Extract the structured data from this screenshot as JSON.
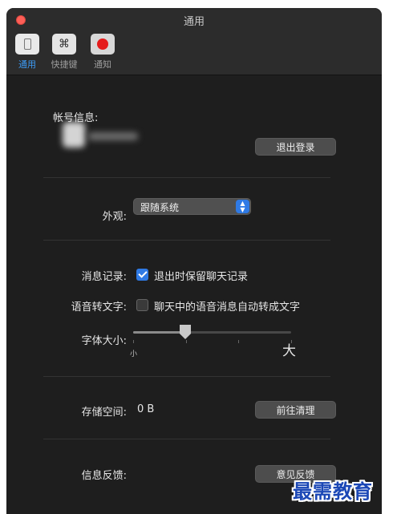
{
  "window": {
    "title": "通用"
  },
  "toolbar": {
    "items": [
      {
        "label": "通用",
        "icon": "general-icon",
        "active": true
      },
      {
        "label": "快捷键",
        "icon": "command-key-icon",
        "glyph": "⌘",
        "active": false
      },
      {
        "label": "通知",
        "icon": "notification-icon",
        "active": false
      }
    ]
  },
  "account": {
    "section_label": "帐号信息:",
    "logout_button": "退出登录"
  },
  "appearance": {
    "label": "外观:",
    "selected": "跟随系统",
    "arrows": "⌃⌄"
  },
  "message_history": {
    "label": "消息记录:",
    "checkbox_label": "退出时保留聊天记录",
    "checked": true
  },
  "voice_to_text": {
    "label": "语音转文字:",
    "checkbox_label": "聊天中的语音消息自动转成文字",
    "checked": false
  },
  "font_size": {
    "label": "字体大小:",
    "small_label": "小",
    "large_label": "大",
    "steps": 4,
    "level": 0.33
  },
  "storage": {
    "label": "存储空间:",
    "value": "0 B",
    "clear_button": "前往清理"
  },
  "feedback": {
    "label": "信息反馈:",
    "button": "意见反馈"
  },
  "watermark": {
    "text": "最需教育"
  },
  "colors": {
    "accent": "#2f7ae5",
    "active_tab": "#3d9bf5",
    "close": "#fe5f57",
    "watermark": "#1b47b6"
  }
}
